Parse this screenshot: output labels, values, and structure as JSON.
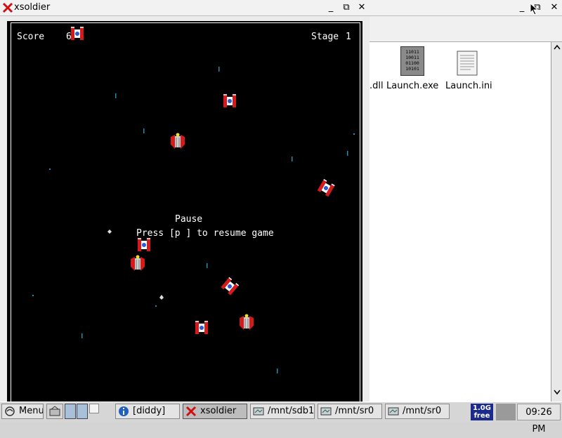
{
  "game_window": {
    "title": "xsoldier",
    "buttons": {
      "minimize": "_",
      "maximize": "⧉",
      "close": "✕"
    },
    "hud": {
      "score_label": "Score",
      "score_value": "6",
      "stage_label": "Stage",
      "stage_value": "1"
    },
    "pause": {
      "title": "Pause",
      "message": "Press [p ] to resume game"
    }
  },
  "file_manager": {
    "buttons": {
      "minimize": "_",
      "maximize": "⧉",
      "close": "✕"
    },
    "files": [
      {
        "name": ".dll",
        "icon": "file-icon-partial"
      },
      {
        "name": "Launch.exe",
        "icon": "binary-file-icon",
        "binary_lines": [
          "11011",
          "10011",
          "01100",
          "10101"
        ]
      },
      {
        "name": "Launch.ini",
        "icon": "text-file-icon"
      }
    ]
  },
  "taskbar": {
    "menu_label": "Menu",
    "tasks": [
      {
        "label": "[diddy]",
        "icon": "info-icon"
      },
      {
        "label": "xsoldier",
        "icon": "x-app-icon"
      },
      {
        "label": "/mnt/sdb1",
        "icon": "folder-window-icon"
      },
      {
        "label": "/mnt/sr0",
        "icon": "folder-window-icon"
      },
      {
        "label": "/mnt/sr0",
        "icon": "folder-window-icon"
      }
    ],
    "memory": {
      "value": "1.0G",
      "label": "free"
    },
    "clock": "09:26 PM"
  },
  "colors": {
    "game_bg": "#000000",
    "ship_red": "#d41a1a",
    "ship_white": "#ffffff",
    "star_blue": "#2a8aa8",
    "memory_bg": "#1c2a8a"
  }
}
